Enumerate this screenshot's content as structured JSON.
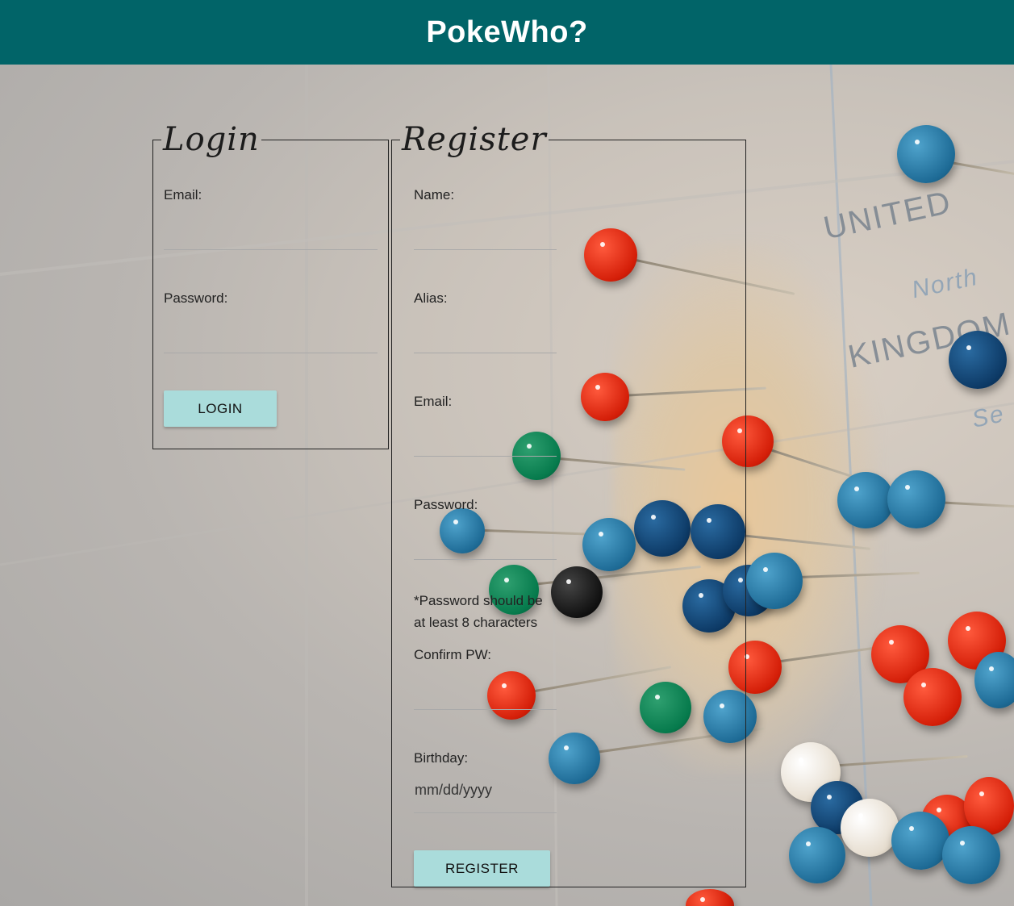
{
  "header": {
    "title": "PokeWho?"
  },
  "login": {
    "legend": "Login",
    "email_label": "Email:",
    "password_label": "Password:",
    "button_label": "LOGIN"
  },
  "register": {
    "legend": "Register",
    "name_label": "Name:",
    "alias_label": "Alias:",
    "email_label": "Email:",
    "password_label": "Password:",
    "password_note_line1": "*Password should be",
    "password_note_line2": "at least 8 characters",
    "confirm_label": "Confirm PW:",
    "birthday_label": "Birthday:",
    "birthday_placeholder": "mm/dd/yyyy",
    "button_label": "REGISTER"
  },
  "background": {
    "map_text": [
      "UNITED",
      "KINGDOM",
      "North",
      "Se"
    ],
    "colors": {
      "header": "#016468",
      "button": "#aadcdb"
    }
  }
}
